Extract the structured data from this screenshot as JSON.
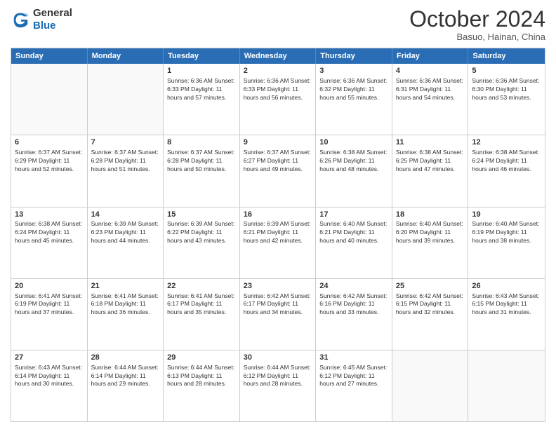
{
  "header": {
    "logo_line1": "General",
    "logo_line2": "Blue",
    "month": "October 2024",
    "location": "Basuo, Hainan, China"
  },
  "days_of_week": [
    "Sunday",
    "Monday",
    "Tuesday",
    "Wednesday",
    "Thursday",
    "Friday",
    "Saturday"
  ],
  "weeks": [
    [
      {
        "day": "",
        "info": ""
      },
      {
        "day": "",
        "info": ""
      },
      {
        "day": "1",
        "info": "Sunrise: 6:36 AM\nSunset: 6:33 PM\nDaylight: 11 hours and 57 minutes."
      },
      {
        "day": "2",
        "info": "Sunrise: 6:36 AM\nSunset: 6:33 PM\nDaylight: 11 hours and 56 minutes."
      },
      {
        "day": "3",
        "info": "Sunrise: 6:36 AM\nSunset: 6:32 PM\nDaylight: 11 hours and 55 minutes."
      },
      {
        "day": "4",
        "info": "Sunrise: 6:36 AM\nSunset: 6:31 PM\nDaylight: 11 hours and 54 minutes."
      },
      {
        "day": "5",
        "info": "Sunrise: 6:36 AM\nSunset: 6:30 PM\nDaylight: 11 hours and 53 minutes."
      }
    ],
    [
      {
        "day": "6",
        "info": "Sunrise: 6:37 AM\nSunset: 6:29 PM\nDaylight: 11 hours and 52 minutes."
      },
      {
        "day": "7",
        "info": "Sunrise: 6:37 AM\nSunset: 6:28 PM\nDaylight: 11 hours and 51 minutes."
      },
      {
        "day": "8",
        "info": "Sunrise: 6:37 AM\nSunset: 6:28 PM\nDaylight: 11 hours and 50 minutes."
      },
      {
        "day": "9",
        "info": "Sunrise: 6:37 AM\nSunset: 6:27 PM\nDaylight: 11 hours and 49 minutes."
      },
      {
        "day": "10",
        "info": "Sunrise: 6:38 AM\nSunset: 6:26 PM\nDaylight: 11 hours and 48 minutes."
      },
      {
        "day": "11",
        "info": "Sunrise: 6:38 AM\nSunset: 6:25 PM\nDaylight: 11 hours and 47 minutes."
      },
      {
        "day": "12",
        "info": "Sunrise: 6:38 AM\nSunset: 6:24 PM\nDaylight: 11 hours and 46 minutes."
      }
    ],
    [
      {
        "day": "13",
        "info": "Sunrise: 6:38 AM\nSunset: 6:24 PM\nDaylight: 11 hours and 45 minutes."
      },
      {
        "day": "14",
        "info": "Sunrise: 6:39 AM\nSunset: 6:23 PM\nDaylight: 11 hours and 44 minutes."
      },
      {
        "day": "15",
        "info": "Sunrise: 6:39 AM\nSunset: 6:22 PM\nDaylight: 11 hours and 43 minutes."
      },
      {
        "day": "16",
        "info": "Sunrise: 6:39 AM\nSunset: 6:21 PM\nDaylight: 11 hours and 42 minutes."
      },
      {
        "day": "17",
        "info": "Sunrise: 6:40 AM\nSunset: 6:21 PM\nDaylight: 11 hours and 40 minutes."
      },
      {
        "day": "18",
        "info": "Sunrise: 6:40 AM\nSunset: 6:20 PM\nDaylight: 11 hours and 39 minutes."
      },
      {
        "day": "19",
        "info": "Sunrise: 6:40 AM\nSunset: 6:19 PM\nDaylight: 11 hours and 38 minutes."
      }
    ],
    [
      {
        "day": "20",
        "info": "Sunrise: 6:41 AM\nSunset: 6:19 PM\nDaylight: 11 hours and 37 minutes."
      },
      {
        "day": "21",
        "info": "Sunrise: 6:41 AM\nSunset: 6:18 PM\nDaylight: 11 hours and 36 minutes."
      },
      {
        "day": "22",
        "info": "Sunrise: 6:41 AM\nSunset: 6:17 PM\nDaylight: 11 hours and 35 minutes."
      },
      {
        "day": "23",
        "info": "Sunrise: 6:42 AM\nSunset: 6:17 PM\nDaylight: 11 hours and 34 minutes."
      },
      {
        "day": "24",
        "info": "Sunrise: 6:42 AM\nSunset: 6:16 PM\nDaylight: 11 hours and 33 minutes."
      },
      {
        "day": "25",
        "info": "Sunrise: 6:42 AM\nSunset: 6:15 PM\nDaylight: 11 hours and 32 minutes."
      },
      {
        "day": "26",
        "info": "Sunrise: 6:43 AM\nSunset: 6:15 PM\nDaylight: 11 hours and 31 minutes."
      }
    ],
    [
      {
        "day": "27",
        "info": "Sunrise: 6:43 AM\nSunset: 6:14 PM\nDaylight: 11 hours and 30 minutes."
      },
      {
        "day": "28",
        "info": "Sunrise: 6:44 AM\nSunset: 6:14 PM\nDaylight: 11 hours and 29 minutes."
      },
      {
        "day": "29",
        "info": "Sunrise: 6:44 AM\nSunset: 6:13 PM\nDaylight: 11 hours and 28 minutes."
      },
      {
        "day": "30",
        "info": "Sunrise: 6:44 AM\nSunset: 6:12 PM\nDaylight: 11 hours and 28 minutes."
      },
      {
        "day": "31",
        "info": "Sunrise: 6:45 AM\nSunset: 6:12 PM\nDaylight: 11 hours and 27 minutes."
      },
      {
        "day": "",
        "info": ""
      },
      {
        "day": "",
        "info": ""
      }
    ]
  ]
}
